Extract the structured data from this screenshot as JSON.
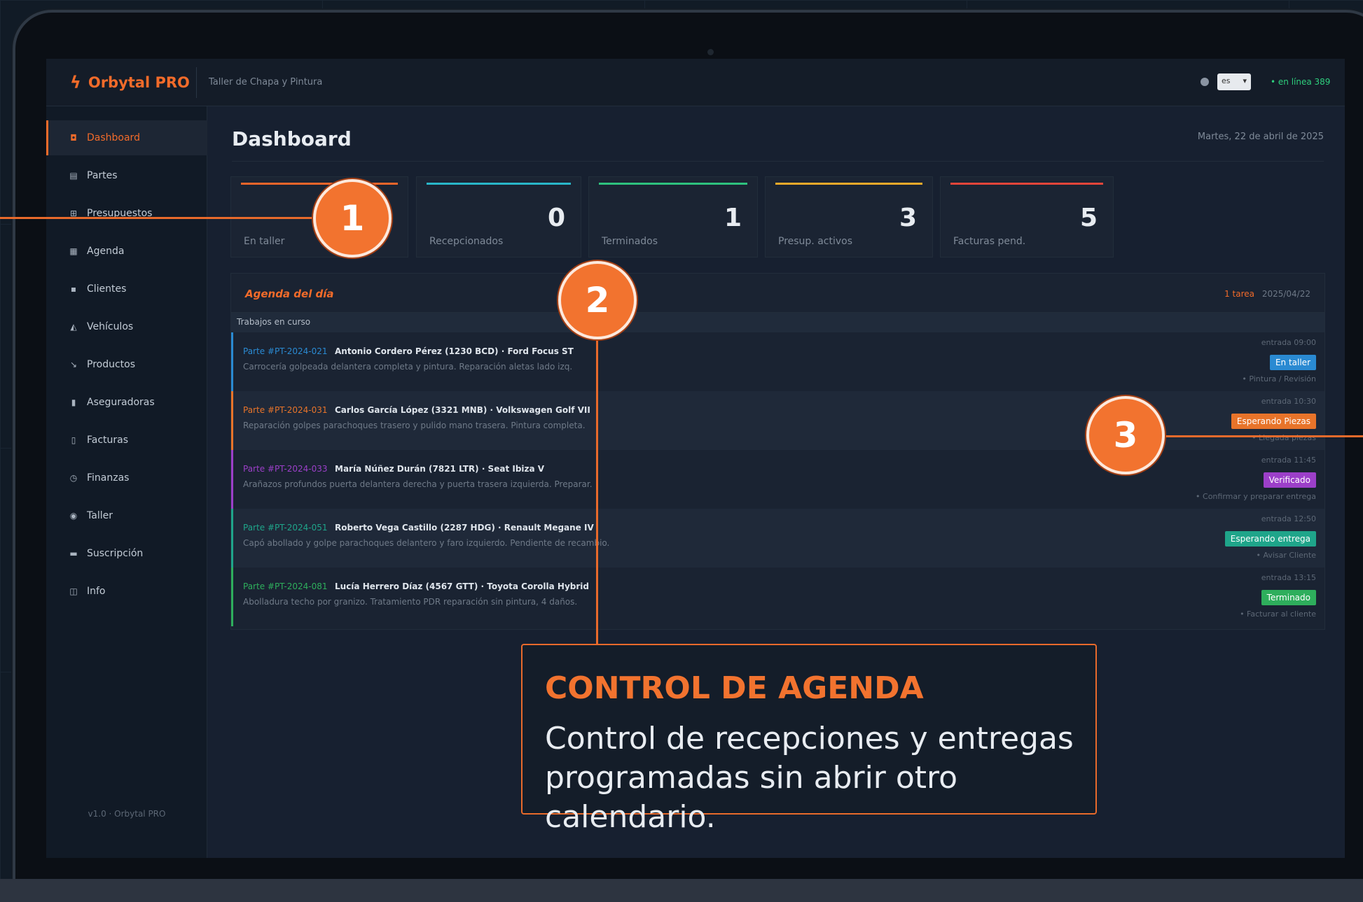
{
  "app": {
    "brand": "Orbytal PRO",
    "subtitle": "Taller de Chapa y Pintura",
    "lang": "es",
    "status": "• en línea 389"
  },
  "sidebar": {
    "items": [
      {
        "label": "Dashboard",
        "icon": "dashboard-icon",
        "glyph": "◘"
      },
      {
        "label": "Partes",
        "icon": "document-icon",
        "glyph": "▤"
      },
      {
        "label": "Presupuestos",
        "icon": "budget-icon",
        "glyph": "⊞"
      },
      {
        "label": "Agenda",
        "icon": "calendar-icon",
        "glyph": "▦"
      },
      {
        "label": "Clientes",
        "icon": "clients-icon",
        "glyph": "▪"
      },
      {
        "label": "Vehículos",
        "icon": "car-icon",
        "glyph": "◭"
      },
      {
        "label": "Productos",
        "icon": "tool-icon",
        "glyph": "↘"
      },
      {
        "label": "Aseguradoras",
        "icon": "shield-icon",
        "glyph": "▮"
      },
      {
        "label": "Facturas",
        "icon": "invoice-icon",
        "glyph": "▯"
      },
      {
        "label": "Finanzas",
        "icon": "finance-icon",
        "glyph": "◷"
      },
      {
        "label": "Taller",
        "icon": "gear-icon",
        "glyph": "◉"
      },
      {
        "label": "Suscripción",
        "icon": "subscription-icon",
        "glyph": "▬"
      },
      {
        "label": "Info",
        "icon": "info-icon",
        "glyph": "◫"
      }
    ],
    "footer": "v1.0 · Orbytal PRO"
  },
  "main": {
    "title": "Dashboard",
    "date": "Martes, 22 de abril de 2025"
  },
  "stats": [
    {
      "value": "1",
      "label": "En taller",
      "color": "#f0652a"
    },
    {
      "value": "0",
      "label": "Recepcionados",
      "color": "#29b6c9"
    },
    {
      "value": "1",
      "label": "Terminados",
      "color": "#2ec27e"
    },
    {
      "value": "3",
      "label": "Presup. activos",
      "color": "#f0a92a"
    },
    {
      "value": "5",
      "label": "Facturas pend.",
      "color": "#e5453a"
    }
  ],
  "agenda": {
    "title": "Agenda del día",
    "meta1": "1 tarea",
    "meta2": "2025/04/22",
    "subheader": "Trabajos en curso",
    "rows": [
      {
        "code": "Parte #PT-2024-021",
        "main": "Antonio Cordero Pérez (1230 BCD) · Ford Focus ST",
        "desc": "Carrocería golpeada delantera completa y pintura. Reparación aletas lado izq.",
        "time": "entrada 09:00",
        "badge": "En taller",
        "badge_color": "#2a8ad2",
        "next": "• Pintura / Revisión",
        "color": "#2a8ad2"
      },
      {
        "code": "Parte #PT-2024-031",
        "main": "Carlos García López (3321 MNB) · Volkswagen Golf VII",
        "desc": "Reparación golpes parachoques trasero y pulido mano trasera. Pintura completa.",
        "time": "entrada 10:30",
        "badge": "Esperando Piezas",
        "badge_color": "#e8742a",
        "next": "• Llegada piezas",
        "color": "#e8742a"
      },
      {
        "code": "Parte #PT-2024-033",
        "main": "María Núñez Durán (7821 LTR) · Seat Ibiza V",
        "desc": "Arañazos profundos puerta delantera derecha y puerta trasera izquierda. Preparar.",
        "time": "entrada 11:45",
        "badge": "Verificado",
        "badge_color": "#9c3fc9",
        "next": "• Confirmar y preparar entrega",
        "color": "#9c3fc9"
      },
      {
        "code": "Parte #PT-2024-051",
        "main": "Roberto Vega Castillo (2287 HDG) · Renault Megane IV",
        "desc": "Capó abollado y golpe parachoques delantero y faro izquierdo. Pendiente de recambio.",
        "time": "entrada 12:50",
        "badge": "Esperando entrega",
        "badge_color": "#1fa58a",
        "next": "• Avisar Cliente",
        "color": "#1fa58a"
      },
      {
        "code": "Parte #PT-2024-081",
        "main": "Lucía Herrero Díaz (4567 GTT) · Toyota Corolla Hybrid",
        "desc": "Abolladura techo por granizo. Tratamiento PDR reparación sin pintura, 4 daños.",
        "time": "entrada 13:15",
        "badge": "Terminado",
        "badge_color": "#2eae5c",
        "next": "• Facturar al cliente",
        "color": "#2eae5c"
      }
    ]
  },
  "callouts": {
    "n1": "1",
    "n2": "2",
    "n3": "3",
    "title": "CONTROL DE AGENDA",
    "text": "Control de recepciones y entregas programadas sin abrir otro calendario."
  }
}
